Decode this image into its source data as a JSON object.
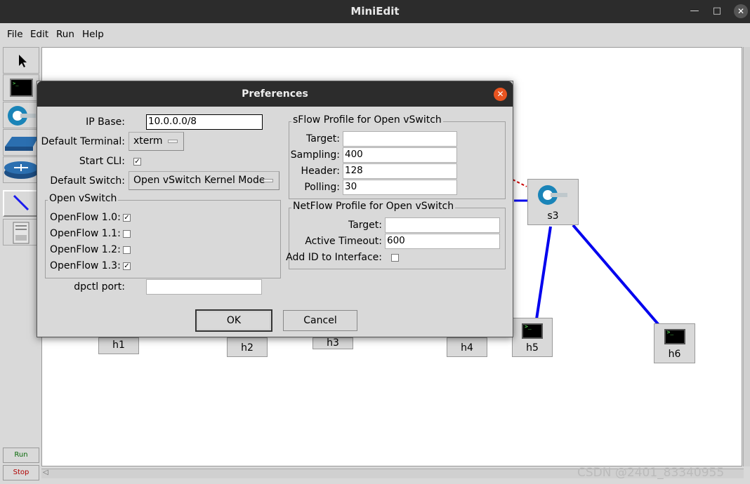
{
  "window": {
    "title": "MiniEdit"
  },
  "menubar": {
    "items": [
      "File",
      "Edit",
      "Run",
      "Help"
    ]
  },
  "toolbar": {
    "tools": [
      "select-tool",
      "host-tool",
      "switch-tool",
      "legacy-switch-tool",
      "router-tool",
      "netlink-tool",
      "controller-tool"
    ],
    "run_label": "Run",
    "stop_label": "Stop"
  },
  "canvas": {
    "nodes": {
      "s3": "s3",
      "h1": "h1",
      "h2": "h2",
      "h3": "h3",
      "h4": "h4",
      "h5": "h5",
      "h6": "h6"
    },
    "link_color": "#0000ee"
  },
  "dialog": {
    "title": "Preferences",
    "ip_base_label": "IP Base:",
    "ip_base_value": "10.0.0.0/8",
    "default_terminal_label": "Default Terminal:",
    "default_terminal_value": "xterm",
    "start_cli_label": "Start CLI:",
    "start_cli_checked": true,
    "default_switch_label": "Default Switch:",
    "default_switch_value": "Open vSwitch Kernel Mode",
    "ovs_frame_title": "Open vSwitch",
    "openflow": [
      {
        "label": "OpenFlow 1.0:",
        "checked": true
      },
      {
        "label": "OpenFlow 1.1:",
        "checked": false
      },
      {
        "label": "OpenFlow 1.2:",
        "checked": false
      },
      {
        "label": "OpenFlow 1.3:",
        "checked": true
      }
    ],
    "dpctl_label": "dpctl port:",
    "dpctl_value": "",
    "sflow": {
      "title": "sFlow Profile for Open vSwitch",
      "target_label": "Target:",
      "target_value": "",
      "sampling_label": "Sampling:",
      "sampling_value": "400",
      "header_label": "Header:",
      "header_value": "128",
      "polling_label": "Polling:",
      "polling_value": "30"
    },
    "netflow": {
      "title": "NetFlow Profile for Open vSwitch",
      "target_label": "Target:",
      "target_value": "",
      "timeout_label": "Active Timeout:",
      "timeout_value": "600",
      "add_id_label": "Add ID to Interface:",
      "add_id_checked": false
    },
    "ok_label": "OK",
    "cancel_label": "Cancel",
    "accent_color": "#e95420"
  },
  "watermark": "CSDN @2401_83340955"
}
